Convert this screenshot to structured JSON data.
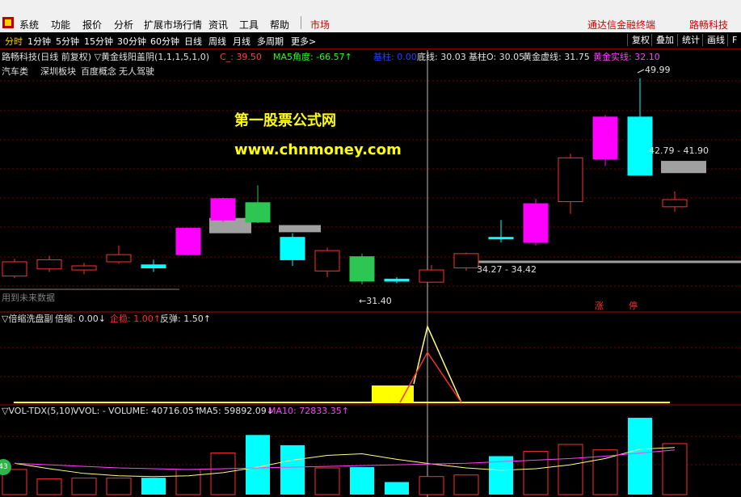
{
  "menubar": {
    "items": [
      "系统",
      "功能",
      "报价",
      "分析",
      "扩展市场行情",
      "资讯",
      "工具",
      "帮助",
      "市场"
    ],
    "brand_text": "通达信金融终端",
    "stock_name": "路畅科技"
  },
  "toolbar": {
    "tabs": [
      "分时",
      "1分钟",
      "5分钟",
      "15分钟",
      "30分钟",
      "60分钟",
      "日线",
      "周线",
      "月线",
      "多周期",
      "更多>"
    ],
    "buttons": [
      "复权",
      "叠加",
      "统计",
      "画线",
      "F"
    ]
  },
  "main_panel": {
    "title": "路畅科技(日线 前复权) ▽黄金线阳盖阴(1,1,1,5,1,0)",
    "c_label": "C_: 39.50",
    "ma5_angle": "MA5角度: -66.57↑",
    "base_line": "基柱: 0.00",
    "bottom_line": "底线: 30.03",
    "base_o": "基柱O: 30.05",
    "gold_dash": "黄金虚线: 31.75",
    "gold_solid": "黄金实线: 32.10",
    "sectors": [
      "汽车类",
      "深圳板块",
      "百度概念",
      "无人驾驶"
    ],
    "watermark_title": "第一股票公式网",
    "watermark_url": "www.chnmoney.com",
    "future_text": "用到未来数据",
    "high_label": "49.99",
    "low_label": "←31.40",
    "range1": "42.79 - 41.90",
    "range2": "34.27 - 34.42",
    "flag_up": "涨",
    "flag_stop": "停"
  },
  "panel2": {
    "title": "▽倍缩洗盘副",
    "label1": "倍缩: 0.00↓",
    "label2": "企稳: 1.00↑",
    "label3": "反弹: 1.50↑"
  },
  "panel3": {
    "title": "▽VOL-TDX(5,10)",
    "vvol": "VVOL: -",
    "volume": "VOLUME: 40716.05↑",
    "ma5": "MA5: 59892.09↓",
    "ma10": "MA10: 72833.35↑"
  },
  "bubble": "43",
  "colors": {
    "up": "#ff3030",
    "down_cyan": "#00ffff",
    "magenta": "#ff00ff",
    "gray_bar": "#a0a0a0",
    "green": "#2dc653",
    "yellow": "#ffff00"
  },
  "candles": [
    {
      "o": 30.6,
      "c": 32.0,
      "h": 32.3,
      "l": 30.4,
      "col": "red"
    },
    {
      "o": 31.3,
      "c": 32.2,
      "h": 32.6,
      "l": 31.0,
      "col": "red"
    },
    {
      "o": 31.2,
      "c": 31.6,
      "h": 31.9,
      "l": 30.8,
      "col": "red"
    },
    {
      "o": 32.0,
      "c": 32.7,
      "h": 33.6,
      "l": 31.8,
      "col": "red"
    },
    {
      "o": 31.7,
      "c": 31.4,
      "h": 32.2,
      "l": 31.0,
      "col": "cyan"
    },
    {
      "o": 32.7,
      "c": 35.3,
      "h": 35.3,
      "l": 32.6,
      "col": "magenta"
    },
    {
      "o": 36.1,
      "c": 38.2,
      "h": 38.3,
      "l": 35.9,
      "col": "magenta"
    },
    {
      "o": 35.9,
      "c": 37.8,
      "h": 39.5,
      "l": 35.8,
      "col": "green"
    },
    {
      "o": 34.4,
      "c": 32.2,
      "h": 34.8,
      "l": 31.6,
      "col": "cyan"
    },
    {
      "o": 33.1,
      "c": 31.1,
      "h": 33.4,
      "l": 30.5,
      "col": "red"
    },
    {
      "o": 32.5,
      "c": 30.1,
      "h": 32.8,
      "l": 29.8,
      "col": "green"
    },
    {
      "o": 30.1,
      "c": 30.3,
      "h": 30.5,
      "l": 29.9,
      "col": "cyan"
    },
    {
      "o": 30.0,
      "c": 31.2,
      "h": 31.7,
      "l": 30.0,
      "col": "red"
    },
    {
      "o": 31.4,
      "c": 32.8,
      "h": 32.9,
      "l": 31.1,
      "col": "red"
    },
    {
      "o": 34.3,
      "c": 34.4,
      "h": 36.1,
      "l": 33.9,
      "col": "cyan"
    },
    {
      "o": 33.9,
      "c": 37.7,
      "h": 38.2,
      "l": 33.6,
      "col": "magenta"
    },
    {
      "o": 37.9,
      "c": 42.2,
      "h": 42.6,
      "l": 36.7,
      "col": "red"
    },
    {
      "o": 42.1,
      "c": 46.2,
      "h": 46.4,
      "l": 41.4,
      "col": "magenta"
    },
    {
      "o": 40.5,
      "c": 46.2,
      "h": 50.0,
      "l": 40.5,
      "col": "cyan"
    },
    {
      "o": 37.4,
      "c": 38.1,
      "h": 38.9,
      "l": 36.9,
      "col": "red"
    }
  ],
  "gray_zones": [
    {
      "idx": 6,
      "top": 36.3,
      "bot": 34.8
    },
    {
      "idx": 8,
      "top": 35.6,
      "bot": 34.9
    },
    {
      "idx": 19,
      "top": 41.9,
      "bot": 40.7
    }
  ],
  "volumes": [
    {
      "v": 32000,
      "col": "red"
    },
    {
      "v": 20000,
      "col": "red"
    },
    {
      "v": 21000,
      "col": "red"
    },
    {
      "v": 21000,
      "col": "red"
    },
    {
      "v": 21500,
      "col": "cyan"
    },
    {
      "v": 32000,
      "col": "red"
    },
    {
      "v": 53000,
      "col": "red"
    },
    {
      "v": 76000,
      "col": "cyan"
    },
    {
      "v": 63000,
      "col": "cyan"
    },
    {
      "v": 34000,
      "col": "red"
    },
    {
      "v": 35000,
      "col": "cyan"
    },
    {
      "v": 16000,
      "col": "cyan"
    },
    {
      "v": 23000,
      "col": "red"
    },
    {
      "v": 25000,
      "col": "red"
    },
    {
      "v": 49000,
      "col": "cyan"
    },
    {
      "v": 55000,
      "col": "red"
    },
    {
      "v": 64000,
      "col": "red"
    },
    {
      "v": 57000,
      "col": "red"
    },
    {
      "v": 98000,
      "col": "cyan"
    },
    {
      "v": 65000,
      "col": "red"
    }
  ],
  "ma5": [
    40000,
    33000,
    27000,
    24000,
    23000,
    24000,
    28000,
    35000,
    44000,
    50000,
    52000,
    45000,
    39000,
    34000,
    31000,
    33000,
    38000,
    46000,
    58000,
    60000
  ],
  "ma10": [
    40000,
    38000,
    36000,
    34000,
    33000,
    32000,
    33000,
    34000,
    35000,
    36000,
    37000,
    38000,
    39000,
    40000,
    42000,
    44000,
    46000,
    49000,
    53000,
    57000
  ]
}
